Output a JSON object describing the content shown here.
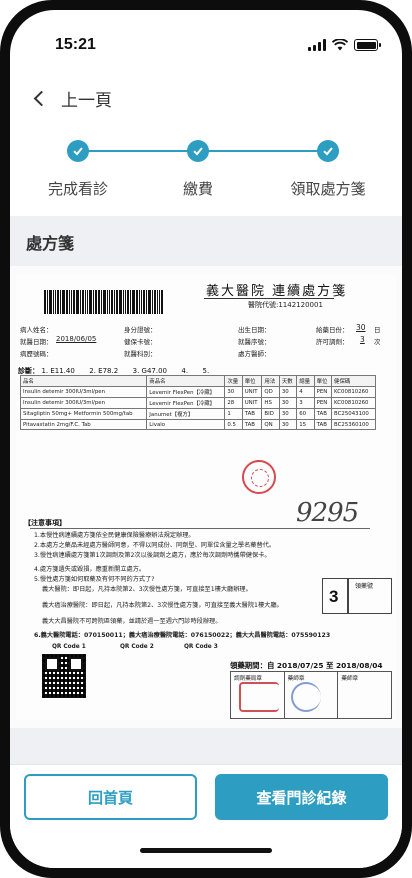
{
  "status_bar": {
    "time": "15:21"
  },
  "nav": {
    "back_label": "上一頁"
  },
  "stepper": {
    "steps": [
      {
        "label": "完成看診",
        "done": true
      },
      {
        "label": "繳費",
        "done": true
      },
      {
        "label": "領取處方箋",
        "done": true
      }
    ],
    "color": "#2d9ec2"
  },
  "section": {
    "title": "處方箋"
  },
  "prescription": {
    "hospital": "義大醫院 連續處方箋",
    "doc_no": "醫院代號:1142120001",
    "fields": {
      "name": "病人姓名：",
      "id_no": "身分證號：",
      "birth": "出生日期：",
      "days_label": "給藥日份：",
      "days_value": "30",
      "days_unit": "日",
      "visit_date_label": "就醫日期：",
      "visit_date": "2018/06/05",
      "card_no": "健保卡號：",
      "visit_seq": "就醫序號：",
      "refill_label": "許可調劑：",
      "refill_value": "3",
      "refill_unit": "次",
      "id_type": "病歷號碼：",
      "dept": "就醫科別：",
      "doctor": "處方醫師："
    },
    "diagnosis_label": "診斷：",
    "diagnoses": [
      "1. E11.40",
      "2. E78.2",
      "3. G47.00",
      "4.",
      "5."
    ],
    "table_headers": [
      "品名",
      "商品名",
      "次量",
      "單位",
      "用法",
      "天數",
      "總量",
      "單位",
      "健保碼"
    ],
    "table_rows": [
      [
        "Insulin detemir 300IU/3ml/pen",
        "Levemir FlexPen【冷藏】",
        "30",
        "UNIT",
        "QD",
        "30",
        "4",
        "PEN",
        "KC00810260"
      ],
      [
        "Insulin detemir 300IU/3ml/pen",
        "Levemir FlexPen【冷藏】",
        "28",
        "UNIT",
        "HS",
        "30",
        "3",
        "PEN",
        "KC00810260"
      ],
      [
        "Sitagliptin 50mg+ Metformin 500mg/tab",
        "Janumet【複方】",
        "1",
        "TAB",
        "BID",
        "30",
        "60",
        "TAB",
        "BC25043100"
      ],
      [
        "Pitavastatin 2mg/F.C. Tab",
        "Livalo",
        "0.5",
        "TAB",
        "QN",
        "30",
        "15",
        "TAB",
        "BC25360100"
      ]
    ],
    "signature": "9295",
    "notes_title": "【注意事項】",
    "notes": [
      "1.本慢性病連續處方箋依全民健康保險醫療辦法規定辦理。",
      "2.本處方之藥品未經處方醫師同意，不得以同成份、同劑型、同單位含量之學名藥替代。",
      "3.慢性病連續處方箋第1次調劑及第2次以後調劑之處方，應於每次調劑時攜帶健保卡。",
      "4.處方箋遺失或毀損，應重新開立處方。",
      "5.慢性處方箋如何取藥及有何不同的方式了?",
      "義大醫院：即日起，凡持本院第2、3次慢性處方箋，可直接至1樓大廳辦理。",
      "義大癌治療醫院：即日起，凡持本院第2、3次慢性處方箋，可直接至義大醫院1樓大廳。",
      "義大大昌醫院不可跨院區領藥，並請於週一至週六門診時段辦理。",
      "6.義大醫院電話：070150011；義大癌治療醫院電話：076150022；義大大昌醫院電話：075590123"
    ],
    "refill_no": "3",
    "refill_box_label": "領藥號",
    "qr_labels": [
      "QR Code 1",
      "QR Code 2",
      "QR Code 3"
    ],
    "period": "領藥期間：自 2018/07/25 至 2018/08/04",
    "period_cells": [
      "調劑藥局章",
      "藥師章",
      "藥師章"
    ]
  },
  "buttons": {
    "home": "回首頁",
    "records": "查看門診紀錄"
  }
}
